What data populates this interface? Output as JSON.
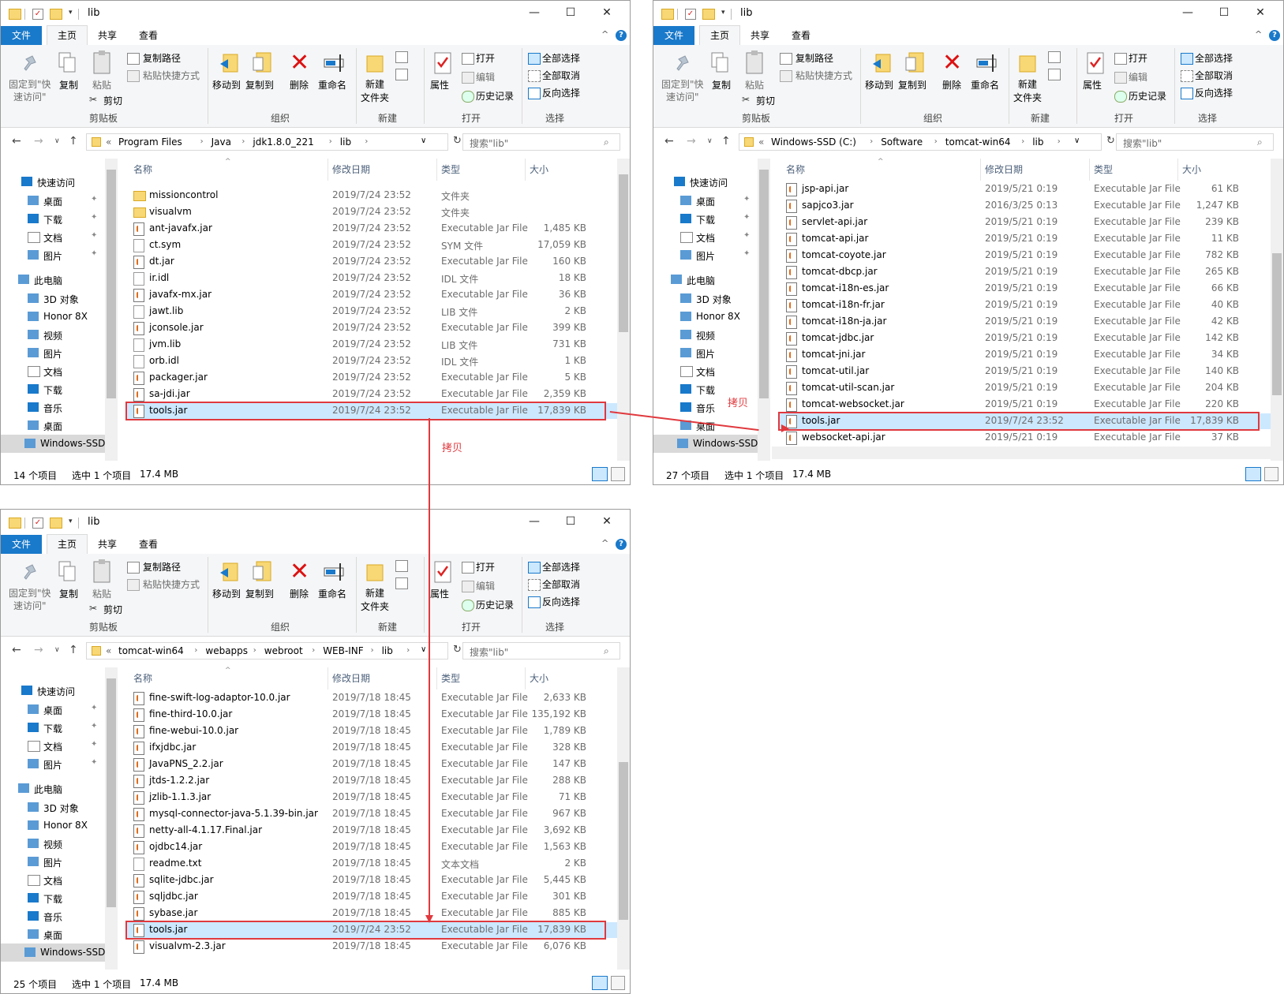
{
  "windows": [
    {
      "title": "lib",
      "tabs": [
        "文件",
        "主页",
        "共享",
        "查看"
      ],
      "ribbon": {
        "pin": "固定到\"快\n速访问\"",
        "copy": "复制",
        "paste": "粘贴",
        "copy_path": "复制路径",
        "paste_shortcut": "粘贴快捷方式",
        "cut": "剪切",
        "clipboard_group": "剪贴板",
        "move_to": "移动到",
        "copy_to": "复制到",
        "delete": "删除",
        "rename": "重命名",
        "organize_group": "组织",
        "new_folder": "新建\n文件夹",
        "new_group": "新建",
        "properties": "属性",
        "open": "打开",
        "edit": "编辑",
        "history": "历史记录",
        "open_group": "打开",
        "select_all": "全部选择",
        "select_none": "全部取消",
        "invert_selection": "反向选择",
        "select_group": "选择"
      },
      "breadcrumb": [
        "Program Files",
        "Java",
        "jdk1.8.0_221",
        "lib"
      ],
      "search_placeholder": "搜索\"lib\"",
      "nav": {
        "quick_access": "快速访问",
        "quick_items": [
          "桌面",
          "下载",
          "文档",
          "图片"
        ],
        "this_pc": "此电脑",
        "pc_items": [
          "3D 对象",
          "Honor 8X",
          "视频",
          "图片",
          "文档",
          "下载",
          "音乐",
          "桌面"
        ],
        "drive": "Windows-SSD"
      },
      "columns": [
        "名称",
        "修改日期",
        "类型",
        "大小"
      ],
      "rows": [
        {
          "icon": "folder",
          "name": "missioncontrol",
          "date": "2019/7/24 23:52",
          "type": "文件夹",
          "size": ""
        },
        {
          "icon": "folder",
          "name": "visualvm",
          "date": "2019/7/24 23:52",
          "type": "文件夹",
          "size": ""
        },
        {
          "icon": "jar",
          "name": "ant-javafx.jar",
          "date": "2019/7/24 23:52",
          "type": "Executable Jar File",
          "size": "1,485 KB"
        },
        {
          "icon": "doc",
          "name": "ct.sym",
          "date": "2019/7/24 23:52",
          "type": "SYM 文件",
          "size": "17,059 KB"
        },
        {
          "icon": "jar",
          "name": "dt.jar",
          "date": "2019/7/24 23:52",
          "type": "Executable Jar File",
          "size": "160 KB"
        },
        {
          "icon": "doc",
          "name": "ir.idl",
          "date": "2019/7/24 23:52",
          "type": "IDL 文件",
          "size": "18 KB"
        },
        {
          "icon": "jar",
          "name": "javafx-mx.jar",
          "date": "2019/7/24 23:52",
          "type": "Executable Jar File",
          "size": "36 KB"
        },
        {
          "icon": "doc",
          "name": "jawt.lib",
          "date": "2019/7/24 23:52",
          "type": "LIB 文件",
          "size": "2 KB"
        },
        {
          "icon": "jar",
          "name": "jconsole.jar",
          "date": "2019/7/24 23:52",
          "type": "Executable Jar File",
          "size": "399 KB"
        },
        {
          "icon": "doc",
          "name": "jvm.lib",
          "date": "2019/7/24 23:52",
          "type": "LIB 文件",
          "size": "731 KB"
        },
        {
          "icon": "doc",
          "name": "orb.idl",
          "date": "2019/7/24 23:52",
          "type": "IDL 文件",
          "size": "1 KB"
        },
        {
          "icon": "jar",
          "name": "packager.jar",
          "date": "2019/7/24 23:52",
          "type": "Executable Jar File",
          "size": "5 KB"
        },
        {
          "icon": "jar",
          "name": "sa-jdi.jar",
          "date": "2019/7/24 23:52",
          "type": "Executable Jar File",
          "size": "2,359 KB"
        },
        {
          "icon": "jar",
          "name": "tools.jar",
          "date": "2019/7/24 23:52",
          "type": "Executable Jar File",
          "size": "17,839 KB",
          "selected": true
        }
      ],
      "status": {
        "count": "14 个项目",
        "selected": "选中 1 个项目",
        "size": "17.4 MB"
      }
    },
    {
      "title": "lib",
      "tabs": [
        "文件",
        "主页",
        "共享",
        "查看"
      ],
      "ribbon": {
        "pin": "固定到\"快\n速访问\"",
        "copy": "复制",
        "paste": "粘贴",
        "copy_path": "复制路径",
        "paste_shortcut": "粘贴快捷方式",
        "cut": "剪切",
        "clipboard_group": "剪贴板",
        "move_to": "移动到",
        "copy_to": "复制到",
        "delete": "删除",
        "rename": "重命名",
        "organize_group": "组织",
        "new_folder": "新建\n文件夹",
        "new_group": "新建",
        "properties": "属性",
        "open": "打开",
        "edit": "编辑",
        "history": "历史记录",
        "open_group": "打开",
        "select_all": "全部选择",
        "select_none": "全部取消",
        "invert_selection": "反向选择",
        "select_group": "选择"
      },
      "breadcrumb": [
        "Windows-SSD (C:)",
        "Software",
        "tomcat-win64",
        "lib"
      ],
      "search_placeholder": "搜索\"lib\"",
      "nav": {
        "quick_access": "快速访问",
        "quick_items": [
          "桌面",
          "下载",
          "文档",
          "图片"
        ],
        "this_pc": "此电脑",
        "pc_items": [
          "3D 对象",
          "Honor 8X",
          "视频",
          "图片",
          "文档",
          "下载",
          "音乐",
          "桌面"
        ],
        "drive": "Windows-SSD"
      },
      "columns": [
        "名称",
        "修改日期",
        "类型",
        "大小"
      ],
      "rows": [
        {
          "icon": "jar",
          "name": "jsp-api.jar",
          "date": "2019/5/21 0:19",
          "type": "Executable Jar File",
          "size": "61 KB"
        },
        {
          "icon": "jar",
          "name": "sapjco3.jar",
          "date": "2016/3/25 0:13",
          "type": "Executable Jar File",
          "size": "1,247 KB"
        },
        {
          "icon": "jar",
          "name": "servlet-api.jar",
          "date": "2019/5/21 0:19",
          "type": "Executable Jar File",
          "size": "239 KB"
        },
        {
          "icon": "jar",
          "name": "tomcat-api.jar",
          "date": "2019/5/21 0:19",
          "type": "Executable Jar File",
          "size": "11 KB"
        },
        {
          "icon": "jar",
          "name": "tomcat-coyote.jar",
          "date": "2019/5/21 0:19",
          "type": "Executable Jar File",
          "size": "782 KB"
        },
        {
          "icon": "jar",
          "name": "tomcat-dbcp.jar",
          "date": "2019/5/21 0:19",
          "type": "Executable Jar File",
          "size": "265 KB"
        },
        {
          "icon": "jar",
          "name": "tomcat-i18n-es.jar",
          "date": "2019/5/21 0:19",
          "type": "Executable Jar File",
          "size": "66 KB"
        },
        {
          "icon": "jar",
          "name": "tomcat-i18n-fr.jar",
          "date": "2019/5/21 0:19",
          "type": "Executable Jar File",
          "size": "40 KB"
        },
        {
          "icon": "jar",
          "name": "tomcat-i18n-ja.jar",
          "date": "2019/5/21 0:19",
          "type": "Executable Jar File",
          "size": "42 KB"
        },
        {
          "icon": "jar",
          "name": "tomcat-jdbc.jar",
          "date": "2019/5/21 0:19",
          "type": "Executable Jar File",
          "size": "142 KB"
        },
        {
          "icon": "jar",
          "name": "tomcat-jni.jar",
          "date": "2019/5/21 0:19",
          "type": "Executable Jar File",
          "size": "34 KB"
        },
        {
          "icon": "jar",
          "name": "tomcat-util.jar",
          "date": "2019/5/21 0:19",
          "type": "Executable Jar File",
          "size": "140 KB"
        },
        {
          "icon": "jar",
          "name": "tomcat-util-scan.jar",
          "date": "2019/5/21 0:19",
          "type": "Executable Jar File",
          "size": "204 KB"
        },
        {
          "icon": "jar",
          "name": "tomcat-websocket.jar",
          "date": "2019/5/21 0:19",
          "type": "Executable Jar File",
          "size": "220 KB"
        },
        {
          "icon": "jar",
          "name": "tools.jar",
          "date": "2019/7/24 23:52",
          "type": "Executable Jar File",
          "size": "17,839 KB",
          "selected": true
        },
        {
          "icon": "jar",
          "name": "websocket-api.jar",
          "date": "2019/5/21 0:19",
          "type": "Executable Jar File",
          "size": "37 KB"
        }
      ],
      "status": {
        "count": "27 个项目",
        "selected": "选中 1 个项目",
        "size": "17.4 MB"
      }
    },
    {
      "title": "lib",
      "tabs": [
        "文件",
        "主页",
        "共享",
        "查看"
      ],
      "ribbon": {
        "pin": "固定到\"快\n速访问\"",
        "copy": "复制",
        "paste": "粘贴",
        "copy_path": "复制路径",
        "paste_shortcut": "粘贴快捷方式",
        "cut": "剪切",
        "clipboard_group": "剪贴板",
        "move_to": "移动到",
        "copy_to": "复制到",
        "delete": "删除",
        "rename": "重命名",
        "organize_group": "组织",
        "new_folder": "新建\n文件夹",
        "new_group": "新建",
        "properties": "属性",
        "open": "打开",
        "edit": "编辑",
        "history": "历史记录",
        "open_group": "打开",
        "select_all": "全部选择",
        "select_none": "全部取消",
        "invert_selection": "反向选择",
        "select_group": "选择"
      },
      "breadcrumb": [
        "tomcat-win64",
        "webapps",
        "webroot",
        "WEB-INF",
        "lib"
      ],
      "search_placeholder": "搜索\"lib\"",
      "nav": {
        "quick_access": "快速访问",
        "quick_items": [
          "桌面",
          "下载",
          "文档",
          "图片"
        ],
        "this_pc": "此电脑",
        "pc_items": [
          "3D 对象",
          "Honor 8X",
          "视频",
          "图片",
          "文档",
          "下载",
          "音乐",
          "桌面"
        ],
        "drive": "Windows-SSD"
      },
      "columns": [
        "名称",
        "修改日期",
        "类型",
        "大小"
      ],
      "rows": [
        {
          "icon": "jar",
          "name": "fine-swift-log-adaptor-10.0.jar",
          "date": "2019/7/18 18:45",
          "type": "Executable Jar File",
          "size": "2,633 KB"
        },
        {
          "icon": "jar",
          "name": "fine-third-10.0.jar",
          "date": "2019/7/18 18:45",
          "type": "Executable Jar File",
          "size": "135,192 KB"
        },
        {
          "icon": "jar",
          "name": "fine-webui-10.0.jar",
          "date": "2019/7/18 18:45",
          "type": "Executable Jar File",
          "size": "1,789 KB"
        },
        {
          "icon": "jar",
          "name": "ifxjdbc.jar",
          "date": "2019/7/18 18:45",
          "type": "Executable Jar File",
          "size": "328 KB"
        },
        {
          "icon": "jar",
          "name": "JavaPNS_2.2.jar",
          "date": "2019/7/18 18:45",
          "type": "Executable Jar File",
          "size": "147 KB"
        },
        {
          "icon": "jar",
          "name": "jtds-1.2.2.jar",
          "date": "2019/7/18 18:45",
          "type": "Executable Jar File",
          "size": "288 KB"
        },
        {
          "icon": "jar",
          "name": "jzlib-1.1.3.jar",
          "date": "2019/7/18 18:45",
          "type": "Executable Jar File",
          "size": "71 KB"
        },
        {
          "icon": "jar",
          "name": "mysql-connector-java-5.1.39-bin.jar",
          "date": "2019/7/18 18:45",
          "type": "Executable Jar File",
          "size": "967 KB"
        },
        {
          "icon": "jar",
          "name": "netty-all-4.1.17.Final.jar",
          "date": "2019/7/18 18:45",
          "type": "Executable Jar File",
          "size": "3,692 KB"
        },
        {
          "icon": "jar",
          "name": "ojdbc14.jar",
          "date": "2019/7/18 18:45",
          "type": "Executable Jar File",
          "size": "1,563 KB"
        },
        {
          "icon": "doc",
          "name": "readme.txt",
          "date": "2019/7/18 18:45",
          "type": "文本文档",
          "size": "2 KB"
        },
        {
          "icon": "jar",
          "name": "sqlite-jdbc.jar",
          "date": "2019/7/18 18:45",
          "type": "Executable Jar File",
          "size": "5,445 KB"
        },
        {
          "icon": "jar",
          "name": "sqljdbc.jar",
          "date": "2019/7/18 18:45",
          "type": "Executable Jar File",
          "size": "301 KB"
        },
        {
          "icon": "jar",
          "name": "sybase.jar",
          "date": "2019/7/18 18:45",
          "type": "Executable Jar File",
          "size": "885 KB"
        },
        {
          "icon": "jar",
          "name": "tools.jar",
          "date": "2019/7/24 23:52",
          "type": "Executable Jar File",
          "size": "17,839 KB",
          "selected": true
        },
        {
          "icon": "jar",
          "name": "visualvm-2.3.jar",
          "date": "2019/7/18 18:45",
          "type": "Executable Jar File",
          "size": "6,076 KB"
        }
      ],
      "status": {
        "count": "25 个项目",
        "selected": "选中 1 个项目",
        "size": "17.4 MB"
      }
    }
  ],
  "annotations": [
    "拷贝",
    "拷贝"
  ],
  "colors": {
    "accent": "#1979ca",
    "highlight": "#e0393e",
    "selection": "#cce8ff"
  }
}
